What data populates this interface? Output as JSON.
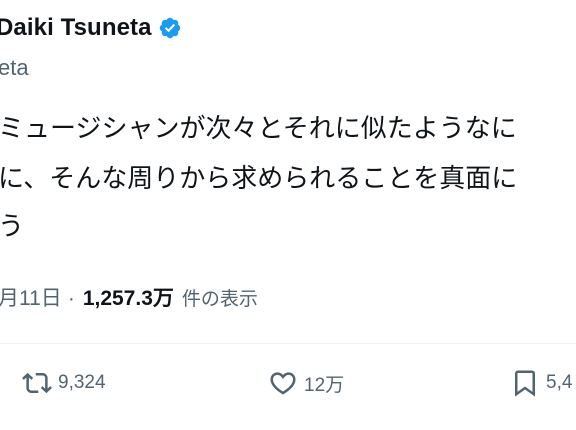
{
  "author": {
    "name": "Daiki Tsuneta",
    "handle": "eta"
  },
  "tweet": {
    "line1": "ミュージシャンが次々とそれに似たようなに",
    "line2": "に、そんな周りから求められることを真面に",
    "line3": "う"
  },
  "meta": {
    "date": "月11日",
    "separator": "·",
    "views_count": "1,257.3万",
    "views_label": "件の表示"
  },
  "actions": {
    "retweets": "9,324",
    "likes": "12万",
    "bookmarks": "5,4"
  },
  "colors": {
    "verified": "#1d9bf0",
    "text_primary": "#0f1419",
    "text_secondary": "#536471",
    "divider": "#eff3f4"
  },
  "icons": {
    "verified": "verified-badge-icon",
    "retweet": "retweet-icon",
    "like": "heart-icon",
    "bookmark": "bookmark-icon"
  }
}
